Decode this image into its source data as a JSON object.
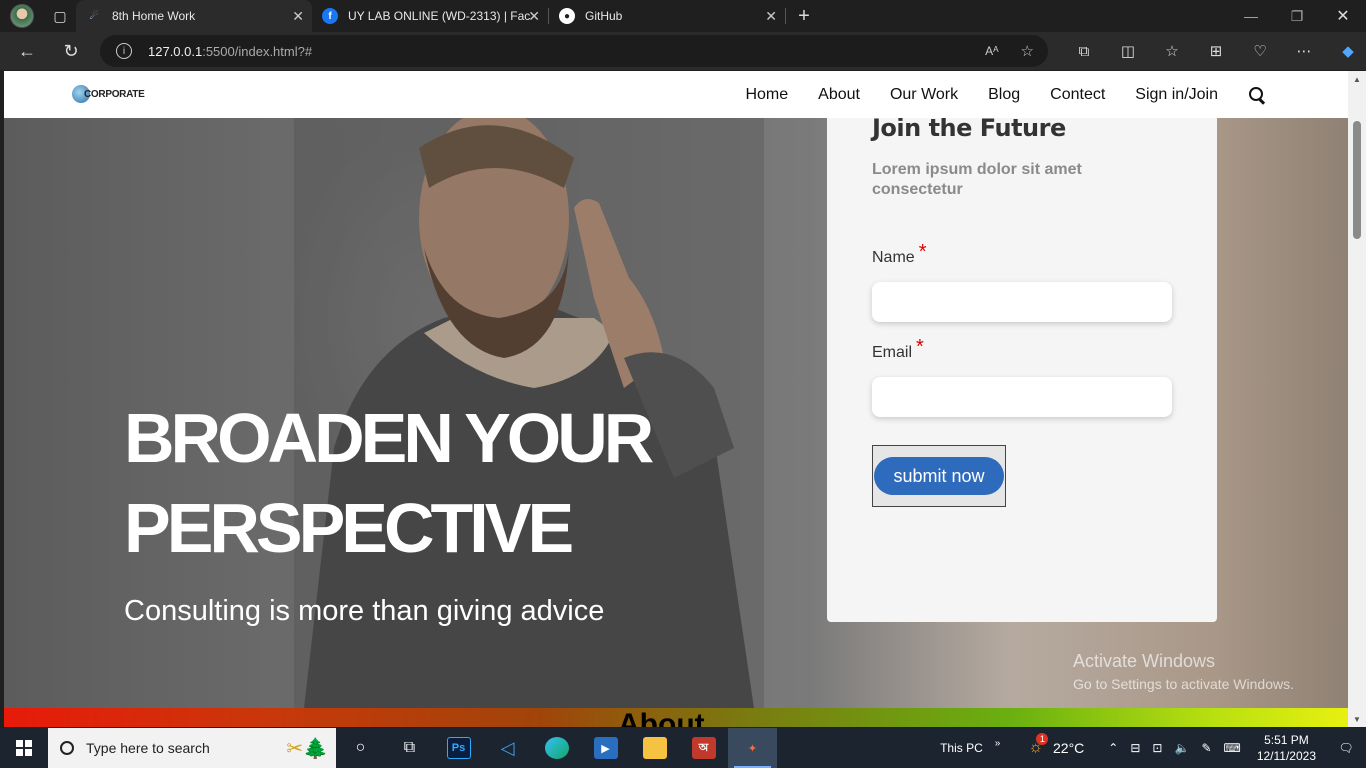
{
  "browser": {
    "tabs": [
      {
        "title": "8th Home Work",
        "active": true
      },
      {
        "title": "UY LAB ONLINE (WD-2313) | Fac",
        "active": false
      },
      {
        "title": "GitHub",
        "active": false
      }
    ],
    "url_host": "127.0.0.1",
    "url_path": ":5500/index.html?#"
  },
  "site": {
    "logo_text": "CORPORATE",
    "nav": [
      "Home",
      "About",
      "Our Work",
      "Blog",
      "Contect",
      "Sign in/Join"
    ]
  },
  "hero": {
    "title_line1": "BROADEN YOUR",
    "title_line2": "PERSPECTIVE",
    "subtitle": "Consulting is more than giving advice"
  },
  "form": {
    "heading": "Join the Future",
    "lead": "Lorem ipsum dolor sit amet consectetur",
    "name_label": "Name",
    "email_label": "Email",
    "required_mark": "*",
    "name_value": "",
    "email_value": "",
    "submit_label": "submit now"
  },
  "strip": {
    "text": "About"
  },
  "watermark": {
    "line1": "Activate Windows",
    "line2": "Go to Settings to activate Windows."
  },
  "taskbar": {
    "search_placeholder": "Type here to search",
    "tray_label": "This PC",
    "weather": "22°C",
    "notification_count": "1",
    "time": "5:51 PM",
    "date": "12/11/2023"
  }
}
